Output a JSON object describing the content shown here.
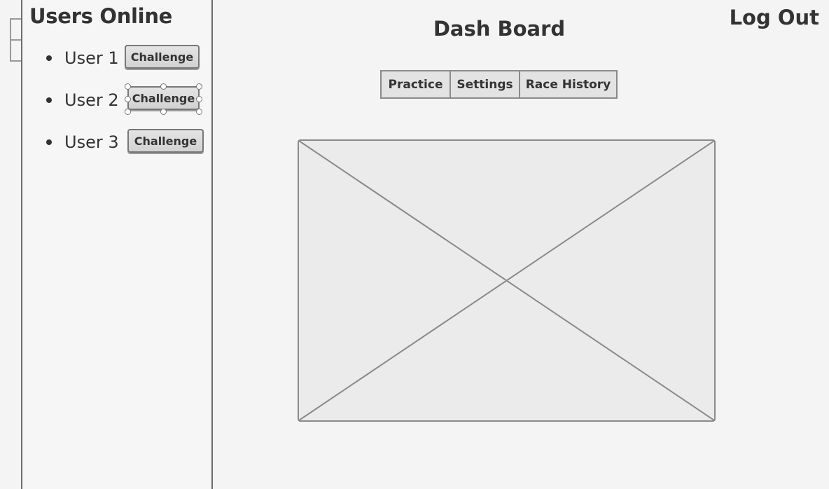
{
  "sidebar": {
    "title": "Users Online",
    "users": [
      {
        "name": "User 1",
        "action_label": "Challenge"
      },
      {
        "name": "User 2",
        "action_label": "Challenge"
      },
      {
        "name": "User 3",
        "action_label": "Challenge"
      }
    ]
  },
  "header": {
    "title": "Dash Board",
    "logout_label": "Log Out"
  },
  "nav": {
    "tabs": [
      {
        "label": "Practice"
      },
      {
        "label": "Settings"
      },
      {
        "label": "Race History"
      }
    ]
  },
  "main": {
    "image_placeholder_icon": "image-placeholder-x"
  },
  "colors": {
    "background": "#f4f4f4",
    "border": "#6b6b6b",
    "button_fill": "#dcdcdc",
    "text": "#333333"
  }
}
